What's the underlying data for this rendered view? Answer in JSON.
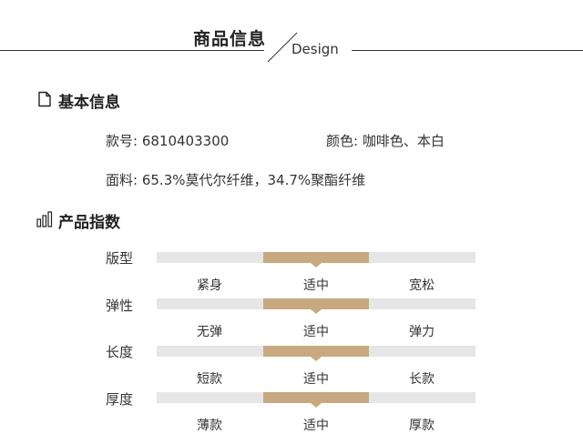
{
  "header": {
    "title": "商品信息",
    "subtitle": "Design"
  },
  "basic": {
    "title": "基本信息",
    "style_no_label": "款号:",
    "style_no_value": "6810403300",
    "color_label": "颜色:",
    "color_value": "咖啡色、本白",
    "material_label": "面料:",
    "material_value": "65.3%莫代尔纤维，34.7%聚酯纤维"
  },
  "index": {
    "title": "产品指数",
    "rows": [
      {
        "label": "版型",
        "options": [
          "紧身",
          "适中",
          "宽松"
        ],
        "selected": 1
      },
      {
        "label": "弹性",
        "options": [
          "无弹",
          "适中",
          "弹力"
        ],
        "selected": 1
      },
      {
        "label": "长度",
        "options": [
          "短款",
          "适中",
          "长款"
        ],
        "selected": 1
      },
      {
        "label": "厚度",
        "options": [
          "薄款",
          "适中",
          "厚款"
        ],
        "selected": 1
      }
    ]
  },
  "colors": {
    "accent": "#c8a97f",
    "track": "#e6e6e6",
    "text": "#222222"
  },
  "icons": {
    "basic": "document-icon",
    "index": "bar-chart-icon"
  }
}
